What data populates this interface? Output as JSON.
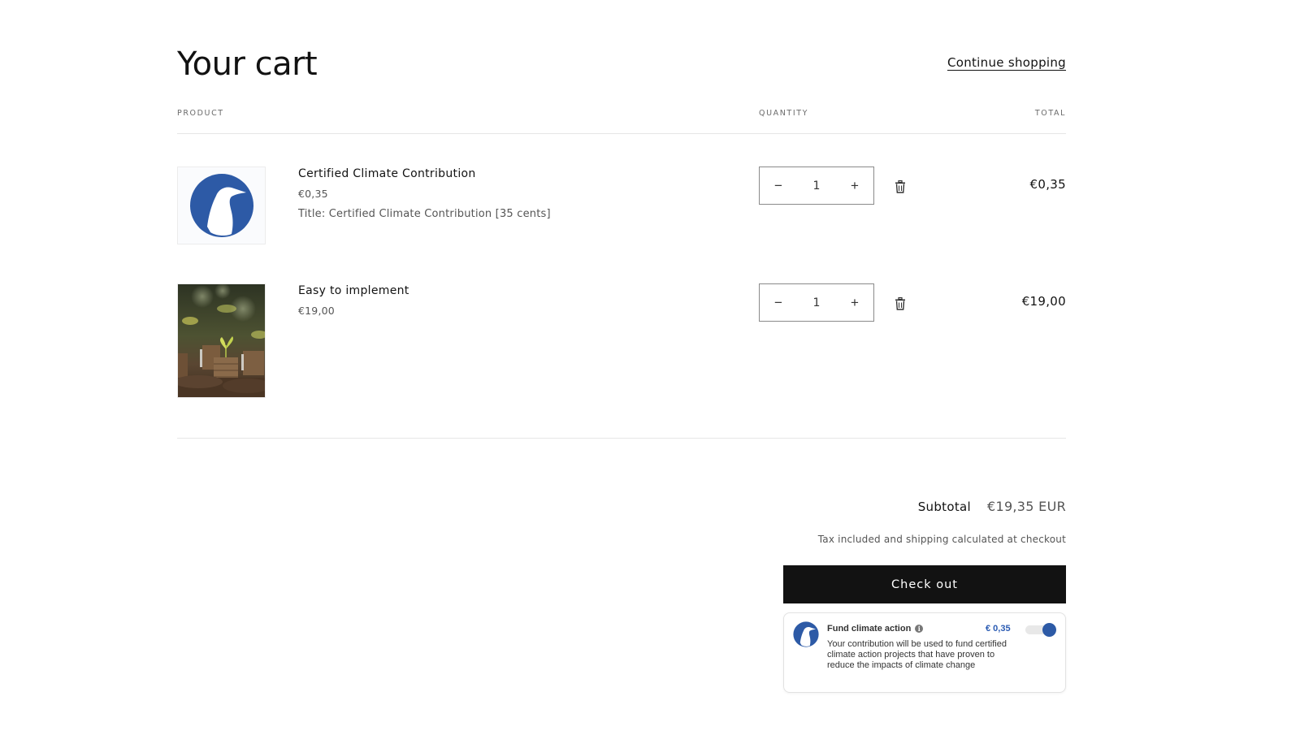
{
  "header": {
    "title": "Your cart",
    "continue_shopping": "Continue shopping"
  },
  "columns": {
    "product": "Product",
    "quantity": "Quantity",
    "total": "Total"
  },
  "items": [
    {
      "name": "Certified Climate Contribution",
      "price": "€0,35",
      "variant": "Title: Certified Climate Contribution [35 cents]",
      "quantity": "1",
      "line_total": "€0,35",
      "image_icon": "penguin-logo-icon"
    },
    {
      "name": "Easy to implement",
      "price": "€19,00",
      "variant": "",
      "quantity": "1",
      "line_total": "€19,00",
      "image_icon": "coins-with-sprouts-photo"
    }
  ],
  "qty_controls": {
    "decrease_icon": "minus-icon",
    "increase_icon": "plus-icon",
    "decrease_symbol": "−",
    "increase_symbol": "+",
    "remove_icon": "trash-icon"
  },
  "summary": {
    "subtotal_label": "Subtotal",
    "subtotal_value": "€19,35 EUR",
    "tax_note": "Tax included and shipping calculated at checkout",
    "checkout_label": "Check out"
  },
  "climate_widget": {
    "title": "Fund climate action",
    "info_symbol": "i",
    "amount": "€ 0,35",
    "toggle_on": true,
    "description": "Your contribution will be used to fund certified climate action projects that have proven to reduce the impacts of climate change"
  },
  "colors": {
    "brand_blue": "#2d5aa6",
    "amount_blue": "#2b5bb3",
    "checkout_bg": "#121212"
  }
}
